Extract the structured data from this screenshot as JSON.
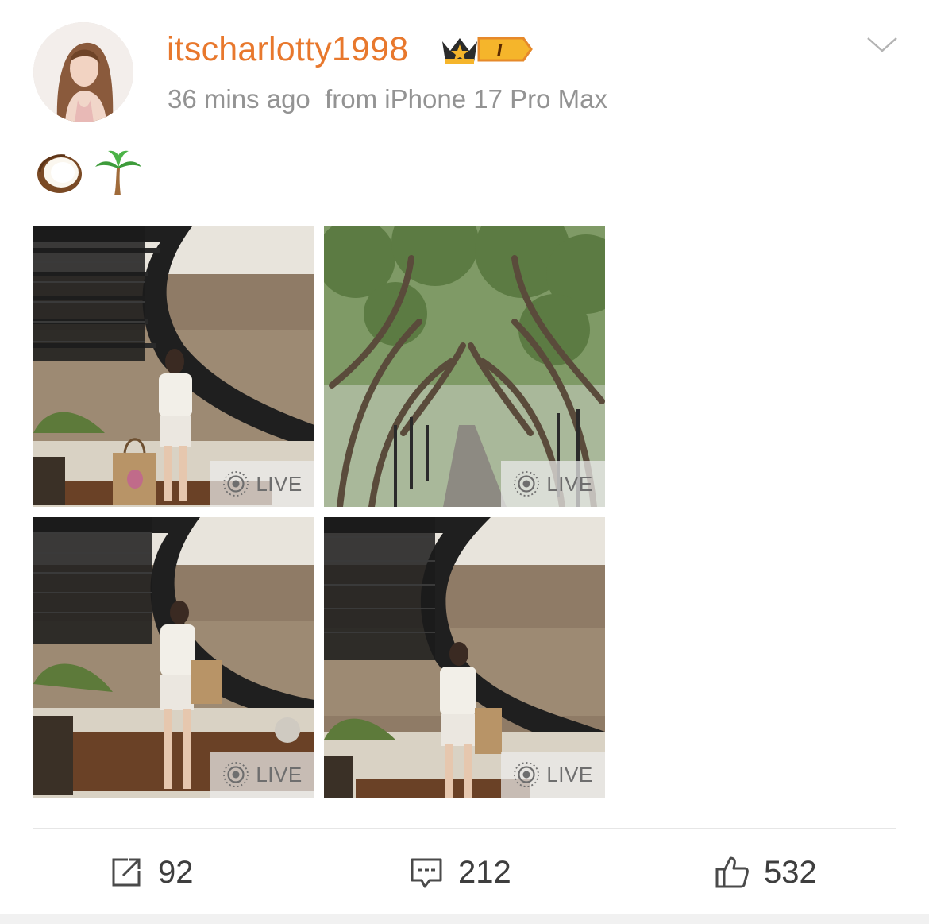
{
  "post": {
    "username": "itscharlotty1998",
    "badge_level": "I",
    "timestamp": "36 mins ago",
    "source": "from iPhone 17 Pro Max",
    "content_emojis": [
      "coconut-emoji",
      "palm-tree-emoji"
    ]
  },
  "photos": [
    {
      "scene": "spiral-staircase-woman-with-tote",
      "live_label": "LIVE"
    },
    {
      "scene": "tree-tunnel-walkway",
      "live_label": "LIVE"
    },
    {
      "scene": "spiral-staircase-woman-posing",
      "live_label": "LIVE"
    },
    {
      "scene": "spiral-staircase-woman-posing-closeup",
      "live_label": "LIVE"
    }
  ],
  "actions": {
    "repost_count": "92",
    "comment_count": "212",
    "like_count": "532"
  },
  "colors": {
    "username": "#e8782d",
    "meta_text": "#939393",
    "badge_gold": "#f5b52b",
    "action_text": "#3e3e3e"
  }
}
